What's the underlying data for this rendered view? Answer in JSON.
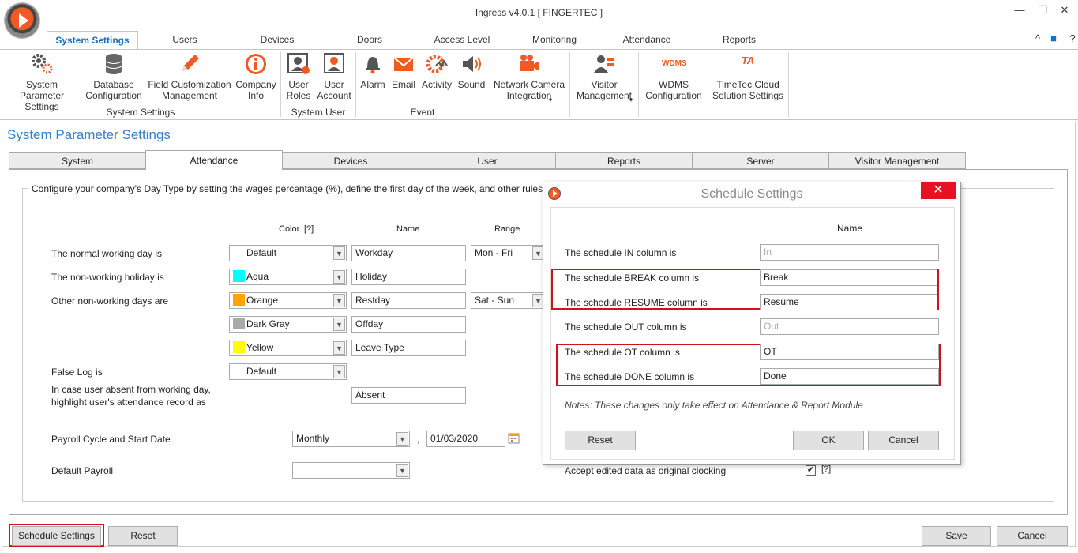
{
  "window": {
    "title": "Ingress v4.0.1 [ FINGERTEC ]",
    "minimize": "—",
    "restore": "❐",
    "close": "✕",
    "help_up": "^",
    "office_icon": "■",
    "help": "?"
  },
  "ribbon_tabs": [
    "System Settings",
    "Users",
    "Devices",
    "Doors",
    "Access Level",
    "Monitoring",
    "Attendance",
    "Reports"
  ],
  "ribbon_buttons": {
    "system_parameter": "System Parameter\nSettings",
    "database_config": "Database\nConfiguration",
    "field_customization": "Field Customization\nManagement",
    "company_info": "Company\nInfo",
    "user_roles": "User\nRoles",
    "user_account": "User\nAccount",
    "alarm": "Alarm",
    "email": "Email",
    "activity": "Activity",
    "sound": "Sound",
    "network_camera": "Network Camera\nIntegration",
    "visitor_mgmt": "Visitor\nManagement",
    "wdms": "WDMS\nConfiguration",
    "timetec": "TimeTec Cloud\nSolution Settings",
    "wdms_logo": "WDMS",
    "ta_logo": "TA"
  },
  "ribbon_groups": {
    "system_settings": "System Settings",
    "system_user": "System User",
    "event": "Event"
  },
  "page": {
    "title": "System Parameter Settings",
    "tabs": [
      "System",
      "Attendance",
      "Devices",
      "User",
      "Reports",
      "Server",
      "Visitor Management"
    ],
    "caption": "Configure your company's Day Type by setting the wages percentage (%), define the first day of the week, and other rules."
  },
  "columns": {
    "color": "Color",
    "color_help": "[?]",
    "name": "Name",
    "range": "Range"
  },
  "rows": {
    "normal_label": "The normal working day is",
    "holiday_label": "The non-working holiday is",
    "other_label": "Other non-working days are",
    "falselog_label": "False Log is",
    "absent_label_1": "In case user absent from working day,",
    "absent_label_2": "highlight user's attendance record as",
    "payroll_cycle_label": "Payroll Cycle and Start Date",
    "default_payroll_label": "Default Payroll"
  },
  "colors": {
    "normal": "Default",
    "holiday": "Aqua",
    "other1": "Orange",
    "other2": "Dark Gray",
    "other3": "Yellow",
    "falselog": "Default"
  },
  "swatches": {
    "aqua": "#00ffff",
    "orange": "#ffa500",
    "darkgray": "#a9a9a9",
    "yellow": "#ffff00"
  },
  "names": {
    "normal": "Workday",
    "holiday": "Holiday",
    "other1": "Restday",
    "other2": "Offday",
    "other3": "Leave Type",
    "absent": "Absent"
  },
  "ranges": {
    "normal": "Mon - Fri",
    "other": "Sat - Sun"
  },
  "payroll": {
    "cycle": "Monthly",
    "comma": ",",
    "start_date": "01/03/2020",
    "default": ""
  },
  "accept_edited": {
    "label": "Accept edited data as original clocking",
    "help": "[?]"
  },
  "buttons": {
    "schedule_settings": "Schedule Settings",
    "reset": "Reset",
    "save": "Save",
    "cancel": "Cancel"
  },
  "dialog": {
    "title": "Schedule Settings",
    "close": "✕",
    "name_header": "Name",
    "in_label": "The schedule IN column is",
    "in_value": "In",
    "break_label": "The schedule BREAK column is",
    "break_value": "Break",
    "resume_label": "The schedule RESUME column is",
    "resume_value": "Resume",
    "out_label": "The schedule OUT column is",
    "out_value": "Out",
    "ot_label": "The schedule OT column is",
    "ot_value": "OT",
    "done_label": "The schedule DONE column is",
    "done_value": "Done",
    "notes": "Notes: These changes only take effect on Attendance & Report Module",
    "reset": "Reset",
    "ok": "OK",
    "cancel": "Cancel"
  },
  "accent": {
    "blue": "#1e6fb8",
    "title_blue": "#3a7fc4",
    "red": "#d0121b",
    "orange_icon": "#f15a24"
  }
}
